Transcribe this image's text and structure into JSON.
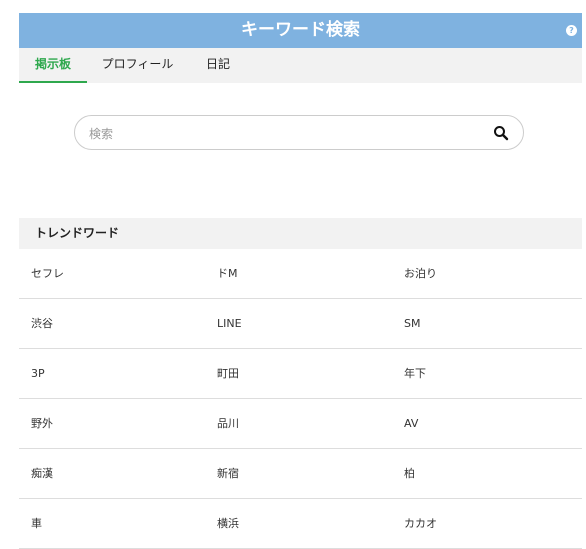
{
  "header": {
    "title": "キーワード検索",
    "help_glyph": "?"
  },
  "tabs": [
    {
      "label": "掲示板",
      "active": true
    },
    {
      "label": "プロフィール",
      "active": false
    },
    {
      "label": "日記",
      "active": false
    }
  ],
  "search": {
    "placeholder": "検索",
    "value": "",
    "icon": "search-icon"
  },
  "trend": {
    "heading": "トレンドワード",
    "rows": [
      [
        "セフレ",
        "ドM",
        "お泊り"
      ],
      [
        "渋谷",
        "LINE",
        "SM"
      ],
      [
        "3P",
        "町田",
        "年下"
      ],
      [
        "野外",
        "品川",
        "AV"
      ],
      [
        "痴漢",
        "新宿",
        "柏"
      ],
      [
        "車",
        "横浜",
        "カカオ"
      ]
    ]
  },
  "colors": {
    "header_bg": "#7fb2e0",
    "tab_bar_bg": "#f2f2f2",
    "active_tab": "#2ea84d",
    "divider": "#dddddd"
  }
}
